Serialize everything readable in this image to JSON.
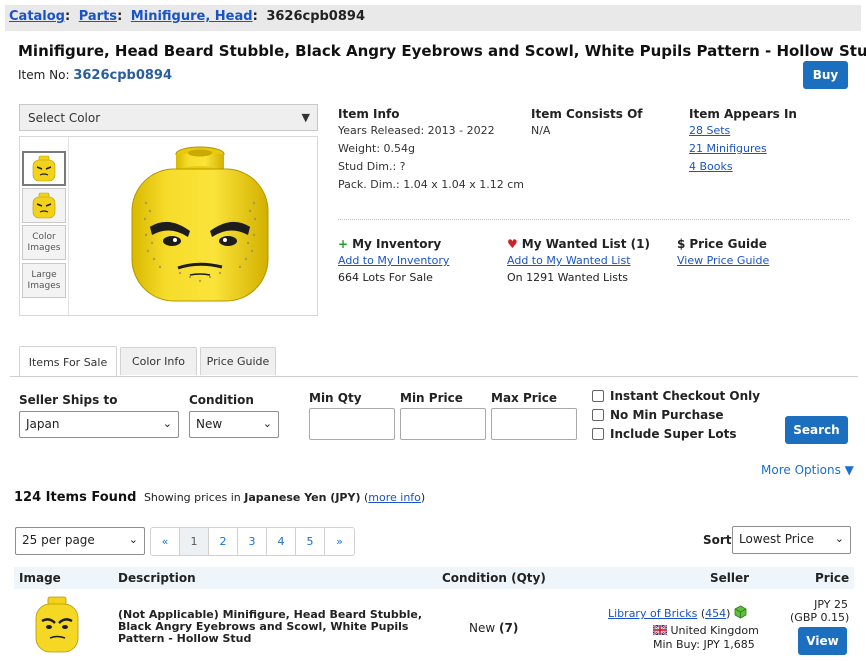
{
  "breadcrumb": {
    "catalog": "Catalog",
    "parts": "Parts",
    "category": "Minifigure, Head",
    "current": "3626cpb0894"
  },
  "item": {
    "title": "Minifigure, Head Beard Stubble, Black Angry Eyebrows and Scowl, White Pupils Pattern - Hollow Stud",
    "item_no_label": "Item No:",
    "item_no": "3626cpb0894",
    "buy_label": "Buy"
  },
  "image_panel": {
    "select_color": "Select Color",
    "thumb_color_images": "Color Images",
    "thumb_large_images": "Large Images"
  },
  "item_info": {
    "heading": "Item Info",
    "years_released": "Years Released: 2013 - 2022",
    "weight": "Weight: 0.54g",
    "stud_dim": "Stud Dim.: ?",
    "pack_dim": "Pack. Dim.: 1.04 x 1.04 x 1.12 cm"
  },
  "consists_of": {
    "heading": "Item Consists Of",
    "value": "N/A"
  },
  "appears_in": {
    "heading": "Item Appears In",
    "sets": "28 Sets",
    "minifigures": "21 Minifigures",
    "books": "4 Books"
  },
  "inventory": {
    "heading": "My Inventory",
    "link": "Add to My Inventory",
    "lots": "664 Lots For Sale",
    "icon_color": "#2a9a2a"
  },
  "wanted": {
    "heading": "My Wanted List (1)",
    "link": "Add to My Wanted List",
    "count": "On 1291 Wanted Lists",
    "icon_color": "#d0202a"
  },
  "price_guide": {
    "heading": "Price Guide",
    "link": "View Price Guide"
  },
  "tabs": [
    {
      "label": "Items For Sale",
      "active": true
    },
    {
      "label": "Color Info",
      "active": false
    },
    {
      "label": "Price Guide",
      "active": false
    }
  ],
  "filters": {
    "ships_to_label": "Seller Ships to",
    "ships_to_value": "Japan",
    "condition_label": "Condition",
    "condition_value": "New",
    "min_qty_label": "Min Qty",
    "min_price_label": "Min Price",
    "max_price_label": "Max Price",
    "instant_checkout": "Instant Checkout Only",
    "no_min_purchase": "No Min Purchase",
    "include_super_lots": "Include Super Lots",
    "search_label": "Search",
    "more_options": "More Options ▼"
  },
  "results": {
    "count": "124 Items Found",
    "showing_prefix": "Showing prices in",
    "currency": "Japanese Yen (JPY)",
    "more_info": "more info"
  },
  "pagination": {
    "per_page": "25 per page",
    "prev": "«",
    "pages": [
      "1",
      "2",
      "3",
      "4",
      "5"
    ],
    "next": "»",
    "current_page": "1",
    "sort_label": "Sort",
    "sort_value": "Lowest Price"
  },
  "table": {
    "headers": {
      "image": "Image",
      "description": "Description",
      "condition": "Condition (Qty)",
      "seller": "Seller",
      "price": "Price"
    },
    "rows": [
      {
        "description": "(Not Applicable) Minifigure, Head Beard Stubble, Black Angry Eyebrows and Scowl, White Pupils Pattern - Hollow Stud",
        "condition": "New",
        "qty": "(7)",
        "seller_name": "Library of Bricks",
        "seller_feedback": "454",
        "country": "United Kingdom",
        "min_buy": "Min Buy: JPY 1,685",
        "price": "JPY 25",
        "price_alt": "(GBP 0.15)",
        "view_label": "View"
      }
    ]
  },
  "colors": {
    "accent": "#1c6fbf",
    "link": "#1a54c4",
    "lego_yellow": "#f2d21a"
  }
}
